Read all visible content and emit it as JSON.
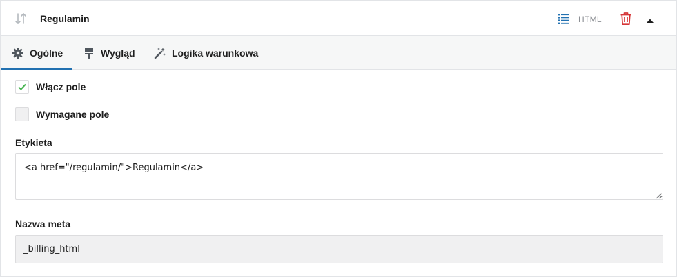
{
  "header": {
    "title": "Regulamin",
    "html_button_label": "HTML",
    "icons": {
      "drag": "sort-arrows-icon",
      "html": "list-icon",
      "delete": "trash-icon",
      "collapse": "caret-up-icon"
    }
  },
  "tabs": [
    {
      "label": "Ogólne",
      "icon": "gear-icon",
      "active": true
    },
    {
      "label": "Wygląd",
      "icon": "paintbrush-icon",
      "active": false
    },
    {
      "label": "Logika warunkowa",
      "icon": "magic-wand-icon",
      "active": false
    }
  ],
  "options": {
    "enable_field": {
      "label": "Włącz pole",
      "checked": true
    },
    "required_field": {
      "label": "Wymagane pole",
      "checked": false
    }
  },
  "label_field": {
    "label": "Etykieta",
    "value": "<a href=\"/regulamin/\">Regulamin</a>"
  },
  "meta_field": {
    "label": "Nazwa meta",
    "value": "_billing_html"
  },
  "colors": {
    "accent": "#2271b1",
    "html_icon": "#2271b1",
    "delete": "#d63638",
    "check": "#46b450",
    "border": "#e2e4e7",
    "tabs_bg": "#f6f7f7",
    "readonly_bg": "#f0f0f1"
  }
}
